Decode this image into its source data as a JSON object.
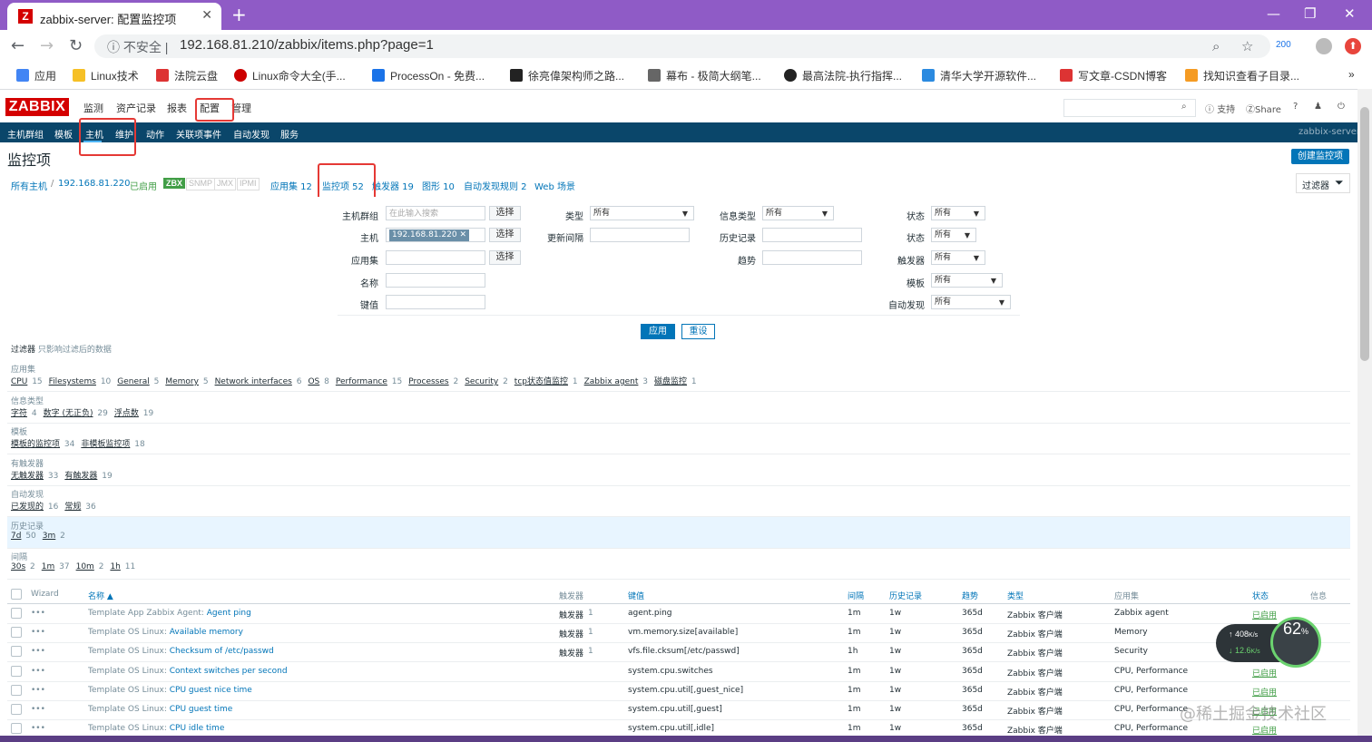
{
  "browser": {
    "tab_title": "zabbix-server: 配置监控项",
    "favicon_letter": "Z",
    "close_glyph": "✕",
    "newtab_glyph": "+",
    "secure_label": "不安全",
    "url": "192.168.81.210/zabbix/items.php?page=1",
    "ext_badge": "200",
    "bookmarks": [
      {
        "label": "应用",
        "color": "#4285f4"
      },
      {
        "label": "Linux技术",
        "color": "#f6c026"
      },
      {
        "label": "法院云盘",
        "color": "#d33"
      },
      {
        "label": "Linux命令大全(手...",
        "color": "#c00"
      },
      {
        "label": "ProcessOn - 免费...",
        "color": "#1a73e8"
      },
      {
        "label": "徐亮偉架构师之路...",
        "color": "#222"
      },
      {
        "label": "幕布 - 极简大纲笔...",
        "color": "#333"
      },
      {
        "label": "最高法院-执行指挥...",
        "color": "#222"
      },
      {
        "label": "清华大学开源软件...",
        "color": "#2b8ae0"
      },
      {
        "label": "写文章-CSDN博客",
        "color": "#d33"
      },
      {
        "label": "找知识查看子目录...",
        "color": "#f59b23"
      }
    ],
    "more_glyph": "»"
  },
  "zabbix": {
    "logo": "ZABBIX",
    "top_menu": [
      "监测",
      "资产记录",
      "报表",
      "配置",
      "管理"
    ],
    "header_links": {
      "support": "支持",
      "share": "Share",
      "help": "?"
    },
    "sub_menu": [
      "主机群组",
      "模板",
      "主机",
      "维护",
      "动作",
      "关联项事件",
      "自动发现",
      "服务"
    ],
    "server_name": "zabbix-server",
    "page_title": "监控项",
    "create_button": "创建监控项",
    "breadcrumb": {
      "all_hosts": "所有主机",
      "sep": "/",
      "host": "192.168.81.220",
      "enabled": "已启用",
      "zbx": "ZBX",
      "snmp": "SNMP",
      "jmx": "JMX",
      "ipmi": "IPMI",
      "tabs": [
        "应用集 12",
        "监控项 52",
        "触发器 19",
        "图形 10",
        "自动发现规则 2",
        "Web 场景"
      ]
    },
    "filter_tab": "过滤器",
    "filter": {
      "hostgroup_label": "主机群组",
      "hostgroup_placeholder": "在此输入搜索",
      "host_label": "主机",
      "host_value": "192.168.81.220",
      "app_label": "应用集",
      "name_label": "名称",
      "key_label": "键值",
      "select_label": "选择",
      "type_label": "类型",
      "type_value": "所有",
      "interval_label": "更新间隔",
      "infotype_label": "信息类型",
      "infotype_value": "所有",
      "history_label": "历史记录",
      "trend_label": "趋势",
      "state_label": "状态",
      "state_value": "所有",
      "status_label": "状态",
      "status_value": "所有",
      "trigger_label": "触发器",
      "trigger_value": "所有",
      "template_label": "模板",
      "template_value": "所有",
      "discovery_label": "自动发现",
      "discovery_value": "所有",
      "apply": "应用",
      "reset": "重设"
    },
    "subfilter_title": "过滤器",
    "subfilter_note": "只影响过滤后的数据",
    "subfilters": [
      {
        "title": "应用集",
        "items": [
          [
            "CPU",
            "15"
          ],
          [
            "Filesystems",
            "10"
          ],
          [
            "General",
            "5"
          ],
          [
            "Memory",
            "5"
          ],
          [
            "Network interfaces",
            "6"
          ],
          [
            "OS",
            "8"
          ],
          [
            "Performance",
            "15"
          ],
          [
            "Processes",
            "2"
          ],
          [
            "Security",
            "2"
          ],
          [
            "tcp状态值监控",
            "1"
          ],
          [
            "Zabbix agent",
            "3"
          ],
          [
            "磁盘监控",
            "1"
          ]
        ]
      },
      {
        "title": "信息类型",
        "items": [
          [
            "字符",
            "4"
          ],
          [
            "数字 (无正负)",
            "29"
          ],
          [
            "浮点数",
            "19"
          ]
        ]
      },
      {
        "title": "模板",
        "items": [
          [
            "模板的监控项",
            "34"
          ],
          [
            "非模板监控项",
            "18"
          ]
        ]
      },
      {
        "title": "有触发器",
        "items": [
          [
            "无触发器",
            "33"
          ],
          [
            "有触发器",
            "19"
          ]
        ]
      },
      {
        "title": "自动发现",
        "items": [
          [
            "已发现的",
            "16"
          ],
          [
            "常规",
            "36"
          ]
        ]
      },
      {
        "title": "历史记录",
        "items": [
          [
            "7d",
            "50"
          ],
          [
            "3m",
            "2"
          ]
        ]
      },
      {
        "title": "间隔",
        "items": [
          [
            "30s",
            "2"
          ],
          [
            "1m",
            "37"
          ],
          [
            "10m",
            "2"
          ],
          [
            "1h",
            "11"
          ]
        ]
      }
    ],
    "table_headers": {
      "wizard": "Wizard",
      "name": "名称 ▲",
      "triggers": "触发器",
      "key": "键值",
      "interval": "间隔",
      "history": "历史记录",
      "trends": "趋势",
      "type": "类型",
      "apps": "应用集",
      "status": "状态",
      "info": "信息"
    },
    "rows": [
      {
        "tpl": "Template App Zabbix Agent:",
        "name": "Agent ping",
        "trig": "触发器",
        "trig_n": "1",
        "key": "agent.ping",
        "interval": "1m",
        "history": "1w",
        "trends": "365d",
        "type": "Zabbix 客户端",
        "apps": "Zabbix agent",
        "status": "已启用"
      },
      {
        "tpl": "Template OS Linux:",
        "name": "Available memory",
        "trig": "触发器",
        "trig_n": "1",
        "key": "vm.memory.size[available]",
        "interval": "1m",
        "history": "1w",
        "trends": "365d",
        "type": "Zabbix 客户端",
        "apps": "Memory",
        "status": ""
      },
      {
        "tpl": "Template OS Linux:",
        "name": "Checksum of /etc/passwd",
        "trig": "触发器",
        "trig_n": "1",
        "key": "vfs.file.cksum[/etc/passwd]",
        "interval": "1h",
        "history": "1w",
        "trends": "365d",
        "type": "Zabbix 客户端",
        "apps": "Security",
        "status": ""
      },
      {
        "tpl": "Template OS Linux:",
        "name": "Context switches per second",
        "trig": "",
        "trig_n": "",
        "key": "system.cpu.switches",
        "interval": "1m",
        "history": "1w",
        "trends": "365d",
        "type": "Zabbix 客户端",
        "apps": "CPU, Performance",
        "status": "已启用"
      },
      {
        "tpl": "Template OS Linux:",
        "name": "CPU guest nice time",
        "trig": "",
        "trig_n": "",
        "key": "system.cpu.util[,guest_nice]",
        "interval": "1m",
        "history": "1w",
        "trends": "365d",
        "type": "Zabbix 客户端",
        "apps": "CPU, Performance",
        "status": "已启用"
      },
      {
        "tpl": "Template OS Linux:",
        "name": "CPU guest time",
        "trig": "",
        "trig_n": "",
        "key": "system.cpu.util[,guest]",
        "interval": "1m",
        "history": "1w",
        "trends": "365d",
        "type": "Zabbix 客户端",
        "apps": "CPU, Performance",
        "status": "已启用"
      },
      {
        "tpl": "Template OS Linux:",
        "name": "CPU idle time",
        "trig": "",
        "trig_n": "",
        "key": "system.cpu.util[,idle]",
        "interval": "1m",
        "history": "1w",
        "trends": "365d",
        "type": "Zabbix 客户端",
        "apps": "CPU, Performance",
        "status": "已启用"
      }
    ]
  },
  "widget": {
    "up": "408",
    "up_unit": "K/s",
    "down": "12.6",
    "down_unit": "K/s",
    "cpu": "62",
    "cpu_unit": "%"
  },
  "watermark": "@稀土掘金技术社区",
  "colors": {
    "accent": "#0275b8",
    "nav": "#0a466a",
    "brand": "#d40000",
    "enabled": "#429e47",
    "highlight": "#e53935"
  }
}
